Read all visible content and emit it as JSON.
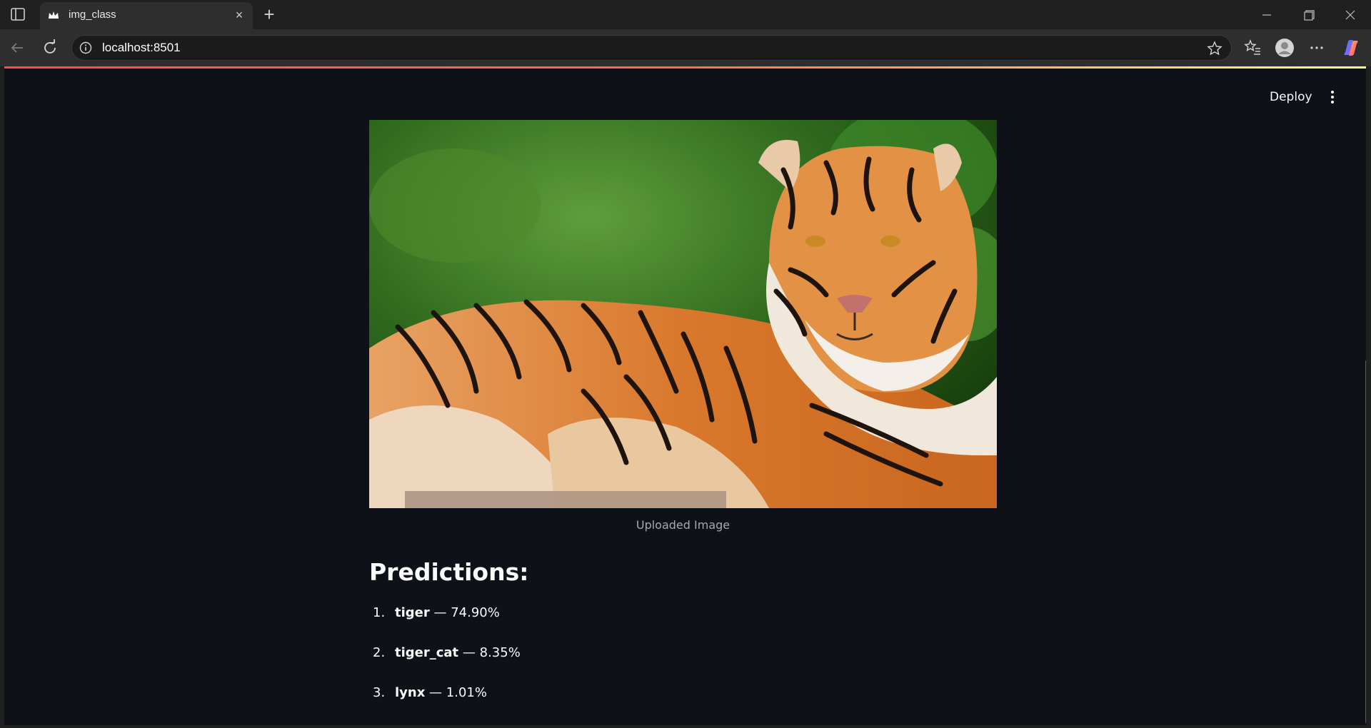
{
  "browser": {
    "tab_title": "img_class",
    "url": "localhost:8501",
    "new_tab_symbol": "+",
    "tab_close_symbol": "×"
  },
  "app": {
    "deploy_label": "Deploy",
    "image_caption": "Uploaded Image",
    "predictions_heading": "Predictions:",
    "predictions": [
      {
        "rank": "1.",
        "label": "tiger",
        "value": " — 74.90%"
      },
      {
        "rank": "2.",
        "label": "tiger_cat",
        "value": " — 8.35%"
      },
      {
        "rank": "3.",
        "label": "lynx",
        "value": " — 1.01%"
      }
    ]
  },
  "colors": {
    "app_background": "#0e1117",
    "accent": "#ff4b4b",
    "text": "#fafafa"
  }
}
